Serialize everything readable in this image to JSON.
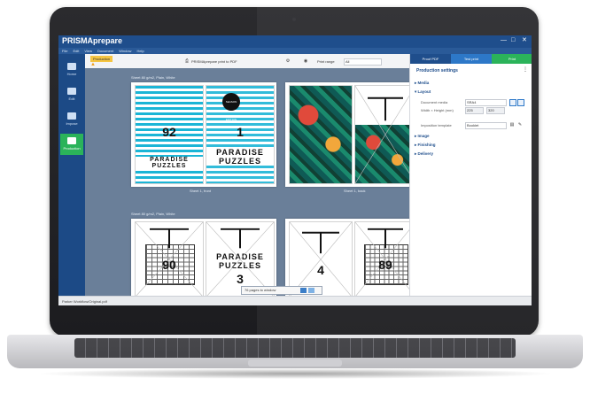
{
  "app": {
    "title": "PRISMAprepare",
    "menu": [
      "File",
      "Edit",
      "View",
      "Document",
      "Window",
      "Help"
    ],
    "window_controls": [
      "—",
      "□",
      "✕"
    ]
  },
  "nav": {
    "items": [
      {
        "label": "Home"
      },
      {
        "label": "Edit"
      },
      {
        "label": "Impose"
      },
      {
        "label": "Production"
      }
    ]
  },
  "toolbar": {
    "doc_tab": "Production",
    "warning_icon": "warning-icon",
    "printer": "PRISMAprepare print to PDF",
    "print_range_label": "Print range",
    "print_range_value": "All"
  },
  "canvas": {
    "sheet_group_1_label": "Sheet 80 g/m2, Plain, White",
    "sheet_group_2_label": "Sheet 80 g/m2, Plain, White",
    "sheet1_front_caption": "Sheet 1, front",
    "sheet1_back_caption": "Sheet 1, back",
    "pages": {
      "p1_number": "92",
      "p2_number": "1",
      "p2_badge": "SEASON EDITION",
      "p1_title": "PARADISE PUZZLES",
      "p2_title": "PARADISE PUZZLES",
      "p5_number": "90",
      "p6_title": "PARADISE PUZZLES",
      "p6_number": "3",
      "p7_number": "4",
      "p8_number": "89"
    },
    "pages_bar_text": "76 pages to window"
  },
  "panel": {
    "tabs": [
      "Proof PDF",
      "Test print",
      "Print"
    ],
    "header": "Production settings",
    "sections": {
      "media": "Media",
      "layout": "Layout",
      "image": "Image",
      "finishing": "Finishing",
      "delivery": "Delivery"
    },
    "document_media_label": "Document media",
    "document_media_value": "SRA4",
    "width_height_label": "Width × Height (mm)",
    "width_value": "225",
    "height_value": "320",
    "imposition_label": "Imposition template",
    "imposition_value": "Booklet"
  },
  "status": {
    "text": "Parker Workflow/Original.pdf"
  },
  "colors": {
    "brand_blue": "#1f4e8c",
    "accent_green": "#2bb35a",
    "canvas_bg": "#6a7f99"
  }
}
